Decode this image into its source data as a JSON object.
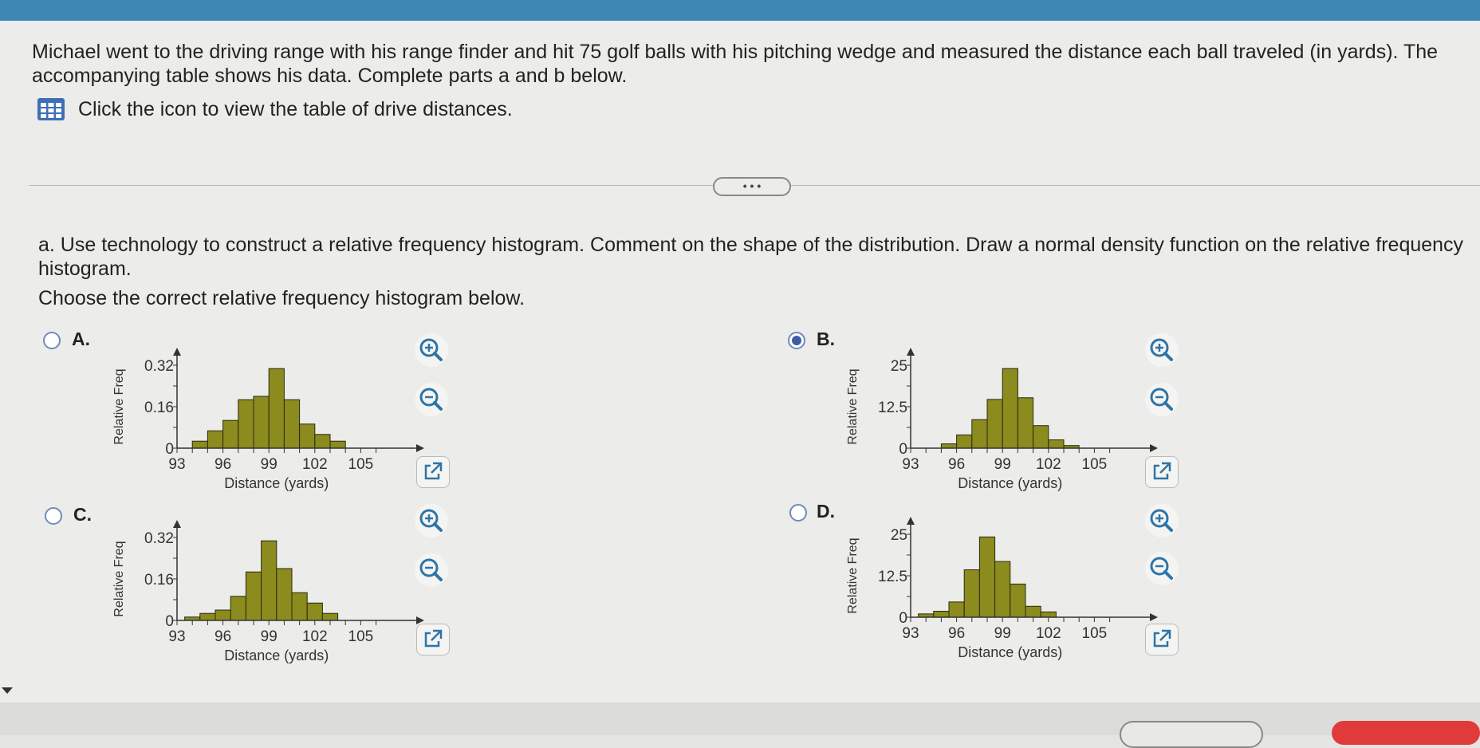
{
  "question": {
    "text": "Michael went to the driving range with his range finder and hit 75 golf balls with his pitching wedge and measured the distance each ball traveled (in yards). The accompanying table shows his data. Complete parts a and b below.",
    "table_link": "Click the icon to view the table of drive distances."
  },
  "more_button": "• • •",
  "part_a": {
    "text": "a. Use technology to construct a relative frequency histogram. Comment on the shape of the distribution. Draw a normal density function on the relative frequency histogram.",
    "instruction": "Choose the correct relative frequency histogram below."
  },
  "options": [
    {
      "letter": "A.",
      "selected": false
    },
    {
      "letter": "B.",
      "selected": true
    },
    {
      "letter": "C.",
      "selected": false
    },
    {
      "letter": "D.",
      "selected": false
    }
  ],
  "icons": {
    "table": "table-icon",
    "zoom_in": "zoom-in-icon",
    "zoom_out": "zoom-out-icon",
    "external": "external-link-icon"
  },
  "colors": {
    "bar_fill": "#8b8b1e",
    "selected_radio": "#3e5da0",
    "header": "#3d87b5"
  },
  "chart_data": [
    {
      "type": "bar",
      "option": "A",
      "ylabel": "Relative Freq",
      "xlabel": "Distance (yards)",
      "xticks": [
        "93",
        "96",
        "99",
        "102",
        "105"
      ],
      "yticks": [
        "0",
        "0.16",
        "0.32"
      ],
      "ylim": [
        0,
        0.32
      ],
      "bin_start": 94,
      "bin_width": 1,
      "values": [
        0.027,
        0.067,
        0.107,
        0.187,
        0.2,
        0.307,
        0.187,
        0.093,
        0.053,
        0.027
      ]
    },
    {
      "type": "bar",
      "option": "B",
      "ylabel": "Relative Freq",
      "xlabel": "Distance (yards)",
      "xticks": [
        "93",
        "96",
        "99",
        "102",
        "105"
      ],
      "yticks": [
        "0",
        "12.5",
        "25"
      ],
      "ylim": [
        0,
        25
      ],
      "bin_start": 95,
      "bin_width": 1,
      "values": [
        1.3,
        4,
        8.6,
        14.7,
        24,
        15.2,
        6.8,
        2.5,
        0.8
      ]
    },
    {
      "type": "bar",
      "option": "C",
      "ylabel": "Relative Freq",
      "xlabel": "Distance (yards)",
      "xticks": [
        "93",
        "96",
        "99",
        "102",
        "105"
      ],
      "yticks": [
        "0",
        "0.16",
        "0.32"
      ],
      "ylim": [
        0,
        0.32
      ],
      "bin_start": 93.5,
      "bin_width": 1,
      "values": [
        0.013,
        0.027,
        0.04,
        0.093,
        0.187,
        0.307,
        0.2,
        0.107,
        0.067,
        0.027
      ]
    },
    {
      "type": "bar",
      "option": "D",
      "ylabel": "Relative Freq",
      "xlabel": "Distance (yards)",
      "xticks": [
        "93",
        "96",
        "99",
        "102",
        "105"
      ],
      "yticks": [
        "0",
        "12.5",
        "25"
      ],
      "ylim": [
        0,
        25
      ],
      "bin_start": 93.5,
      "bin_width": 1,
      "values": [
        1,
        1.8,
        4.6,
        14.3,
        24.2,
        16.8,
        10,
        3.3,
        1.6
      ]
    }
  ]
}
